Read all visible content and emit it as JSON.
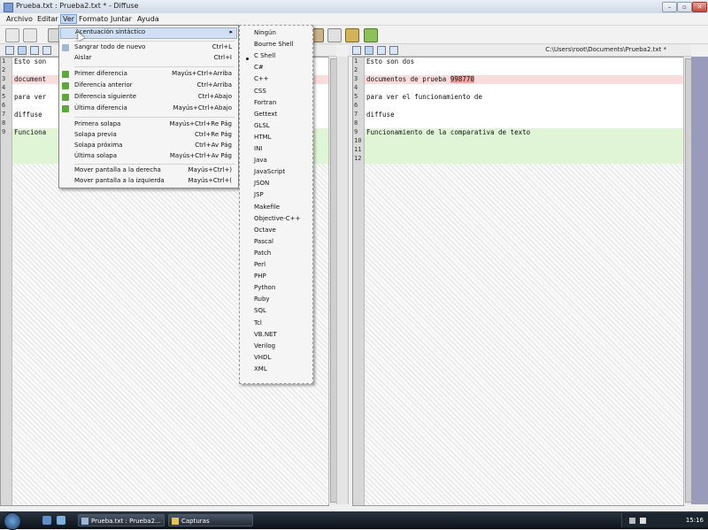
{
  "window": {
    "title": "Prueba.txt : Prueba2.txt * - Diffuse",
    "controls": {
      "minimize": "–",
      "maximize": "▫",
      "close": "✕"
    }
  },
  "menubar": [
    "Archivo",
    "Editar",
    "Ver",
    "Formato",
    "Juntar",
    "Ayuda"
  ],
  "right_pane": {
    "path": "C:\\Users\\root\\Documents\\Prueba2.txt *",
    "lines": [
      {
        "n": "1",
        "text": "Esto son dos"
      },
      {
        "n": "2",
        "text": ""
      },
      {
        "n": "3",
        "text": "documentos de prueba ",
        "highlight": "998770"
      },
      {
        "n": "4",
        "text": ""
      },
      {
        "n": "5",
        "text": "para ver el funcionamiento de"
      },
      {
        "n": "6",
        "text": ""
      },
      {
        "n": "7",
        "text": "diffuse"
      },
      {
        "n": "8",
        "text": ""
      },
      {
        "n": "9",
        "text": "Funcionamiento de la comparativa de texto"
      },
      {
        "n": "10",
        "text": ""
      },
      {
        "n": "11",
        "text": ""
      },
      {
        "n": "12",
        "text": ""
      }
    ]
  },
  "left_pane": {
    "lines": [
      {
        "n": "1",
        "text": "Esto son"
      },
      {
        "n": "2",
        "text": ""
      },
      {
        "n": "3",
        "text": "document"
      },
      {
        "n": "4",
        "text": ""
      },
      {
        "n": "5",
        "text": "para ver"
      },
      {
        "n": "6",
        "text": ""
      },
      {
        "n": "7",
        "text": "diffuse"
      },
      {
        "n": "8",
        "text": ""
      },
      {
        "n": "9",
        "text": "Funciona"
      }
    ]
  },
  "ver_menu": {
    "items": [
      {
        "label": "Acentuación sintáctico",
        "shortcut": "▸"
      },
      {
        "label": "Sangrar todo de nuevo",
        "shortcut": "Ctrl+L"
      },
      {
        "label": "Aislar",
        "shortcut": "Ctrl+I"
      },
      {
        "label": "Primer diferencia",
        "shortcut": "Mayús+Ctrl+Arriba"
      },
      {
        "label": "Diferencia anterior",
        "shortcut": "Ctrl+Arriba"
      },
      {
        "label": "Diferencia siguiente",
        "shortcut": "Ctrl+Abajo"
      },
      {
        "label": "Última diferencia",
        "shortcut": "Mayús+Ctrl+Abajo"
      },
      {
        "label": "Primera solapa",
        "shortcut": "Mayús+Ctrl+Re Pág"
      },
      {
        "label": "Solapa previa",
        "shortcut": "Ctrl+Re Pág"
      },
      {
        "label": "Solapa próxima",
        "shortcut": "Ctrl+Av Pág"
      },
      {
        "label": "Última solapa",
        "shortcut": "Mayús+Ctrl+Av Pág"
      },
      {
        "label": "Mover pantalla a la derecha",
        "shortcut": "Mayús+Ctrl+)"
      },
      {
        "label": "Mover pantalla a la izquierda",
        "shortcut": "Mayús+Ctrl+("
      }
    ]
  },
  "syntax_menu": {
    "items": [
      "Ningún",
      "Bourne Shell",
      "C Shell",
      "C#",
      "C++",
      "CSS",
      "Fortran",
      "Gettext",
      "GLSL",
      "HTML",
      "INI",
      "Java",
      "JavaScript",
      "JSON",
      "JSP",
      "Makefile",
      "Objective-C++",
      "Octave",
      "Pascal",
      "Patch",
      "Perl",
      "PHP",
      "Python",
      "Ruby",
      "SQL",
      "Tcl",
      "VB.NET",
      "Verilog",
      "VHDL",
      "XML"
    ]
  },
  "taskbar": {
    "tasks": [
      "Prueba.txt : Prueba2...",
      "Capturas"
    ],
    "clock": "15:16"
  },
  "colors": {
    "diff_removed": "#fbdcdc",
    "diff_added": "#dff5d5",
    "changed_word": "#f5a3a3",
    "menu_highlight": "#cfe0f5"
  }
}
